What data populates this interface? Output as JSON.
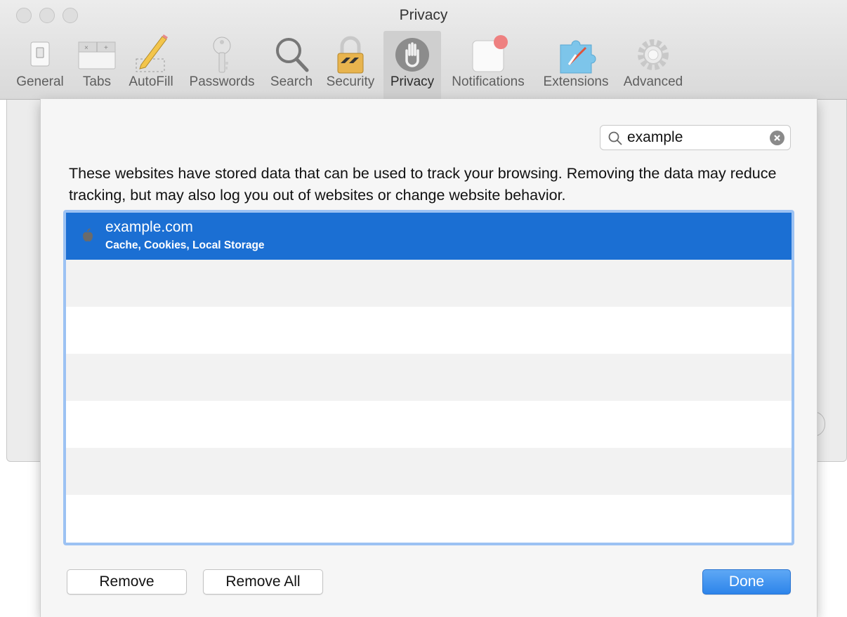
{
  "window": {
    "title": "Privacy"
  },
  "toolbar": {
    "items": [
      {
        "label": "General",
        "icon": "general-switch-icon"
      },
      {
        "label": "Tabs",
        "icon": "tabs-icon"
      },
      {
        "label": "AutoFill",
        "icon": "pencil-icon"
      },
      {
        "label": "Passwords",
        "icon": "key-icon"
      },
      {
        "label": "Search",
        "icon": "magnifier-icon"
      },
      {
        "label": "Security",
        "icon": "padlock-icon"
      },
      {
        "label": "Privacy",
        "icon": "hand-icon",
        "selected": true
      },
      {
        "label": "Notifications",
        "icon": "notification-badge-icon"
      },
      {
        "label": "Extensions",
        "icon": "puzzle-piece-icon"
      },
      {
        "label": "Advanced",
        "icon": "gear-icon"
      }
    ]
  },
  "sheet": {
    "search": {
      "value": "example"
    },
    "description": "These websites have stored data that can be used to track your browsing. Removing the data may reduce tracking, but may also log you out of websites or change website behavior.",
    "websites": [
      {
        "name": "example.com",
        "data": "Cache, Cookies, Local Storage",
        "selected": true
      }
    ],
    "buttons": {
      "remove": "Remove",
      "remove_all": "Remove All",
      "done": "Done"
    }
  },
  "colors": {
    "selection": "#1b6fd3",
    "list_focus": "#9cc2f3",
    "primary_button": "#2d84ea"
  }
}
